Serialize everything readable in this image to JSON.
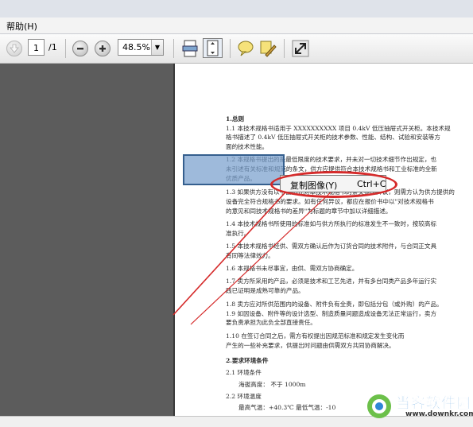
{
  "menubar": {
    "help_label": "帮助(H)"
  },
  "toolbar": {
    "page_current": "1",
    "page_total": "/1",
    "zoom_value": "48.5%",
    "icons": [
      "arrow-down-icon",
      "zoom-out-icon",
      "zoom-in-icon",
      "fit-width-icon",
      "fit-page-icon",
      "comment-icon",
      "sign-icon",
      "fullscreen-icon"
    ]
  },
  "context_menu": {
    "copy_image_label": "复制图像(Y)",
    "shortcut": "Ctrl+C"
  },
  "document": {
    "lines": [
      "1.总则",
      "1.1 本技术规格书适用于 XXXXXXXXXX 项目 0.4kV 低压抽屉式开关柜。本技术规",
      "格书描述了 0.4kV 低压抽屉式开关柜的技术参数、性能、结构、试验和安装等方",
      "面的技术性能。",
      "1.2 本规格书提出的是最低限度的技术要求，并未对一切技术细节作出规定，也",
      "未引述有关标准和规范的条文，供方应提供符合本技术规格书和工业标准的全新",
      "优质产品。",
      "1.3 如果供方没有以书面形式对本技术规格书的条文提出异议，则需方认为供方提供的",
      "设备完全符合规格书的要求。如有任何异议，都应在报价书中以\"对技术规格书",
      "的意见和同技术规格书的差异\"为标题的章节中加以详细描述。",
      "1.4 本技术规格书所使用的标准如与供方所执行的标准发生不一致时，按较高标",
      "准执行。",
      "1.5 本技术规格书经供、需双方确认后作为订货合同的技术附件，与合同正文具",
      "有同等法律效力。",
      "1.6 本规格书未尽事宜，由供、需双方协商确定。",
      "1.7 卖方所采用的产品，必须是技术和工艺先进，并有多台同类产品多年运行实",
      "践已证明是成熟可靠的产品。",
      "1.8 卖方应对所供范围内的设备、附件负有全责，即包括分包（或外购）的产品。",
      "1.9 如因设备、附件等的设计选型、制造质量问题造成设备无法正常运行，卖方",
      "要负责承担为此负全部直接责任。",
      "1.10 在签订合同之后，需方有权提出因规范标准和规定发生变化而",
      "产生的一些补充要求，供提出时问题由供需双方共同协商解决。",
      "2.要求环境条件",
      "2.1 环境条件",
      "海拔高度：          不于 1000m",
      "2.2 环境温度",
      "最高气温：+40.3℃                         最低气温：-10"
    ]
  },
  "watermark": {
    "brand": "当客软件园",
    "url": "www.downkr.com"
  },
  "colors": {
    "annotation": "#d52a2a",
    "selection": "#78a0cd",
    "panel_bg": "#5c5c5c"
  }
}
